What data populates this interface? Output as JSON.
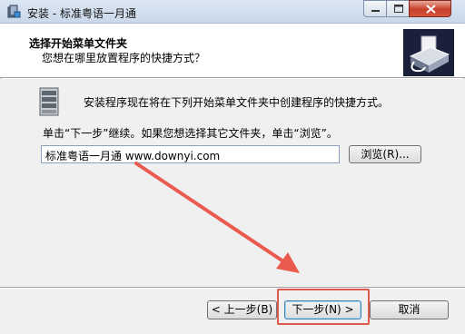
{
  "window": {
    "title": "安装 - 标准粤语一月通",
    "minimize_icon": "minimize-icon",
    "maximize_icon": "maximize-icon",
    "close_icon": "close-icon"
  },
  "header": {
    "title": "选择开始菜单文件夹",
    "subtitle": "您想在哪里放置程序的快捷方式？"
  },
  "body": {
    "description": "安装程序现在将在下列开始菜单文件夹中创建程序的快捷方式。",
    "instruction": "单击“下一步”继续。如果您想选择其它文件夹，单击“浏览”。",
    "folder_value": "标准粤语一月通 www.downyi.com",
    "browse_label": "浏览(R)..."
  },
  "footer": {
    "back_label": "< 上一步(B)",
    "next_label": "下一步(N) >",
    "cancel_label": "取消"
  },
  "colors": {
    "annotation": "#e85b4e",
    "close_button": "#c7402b"
  }
}
